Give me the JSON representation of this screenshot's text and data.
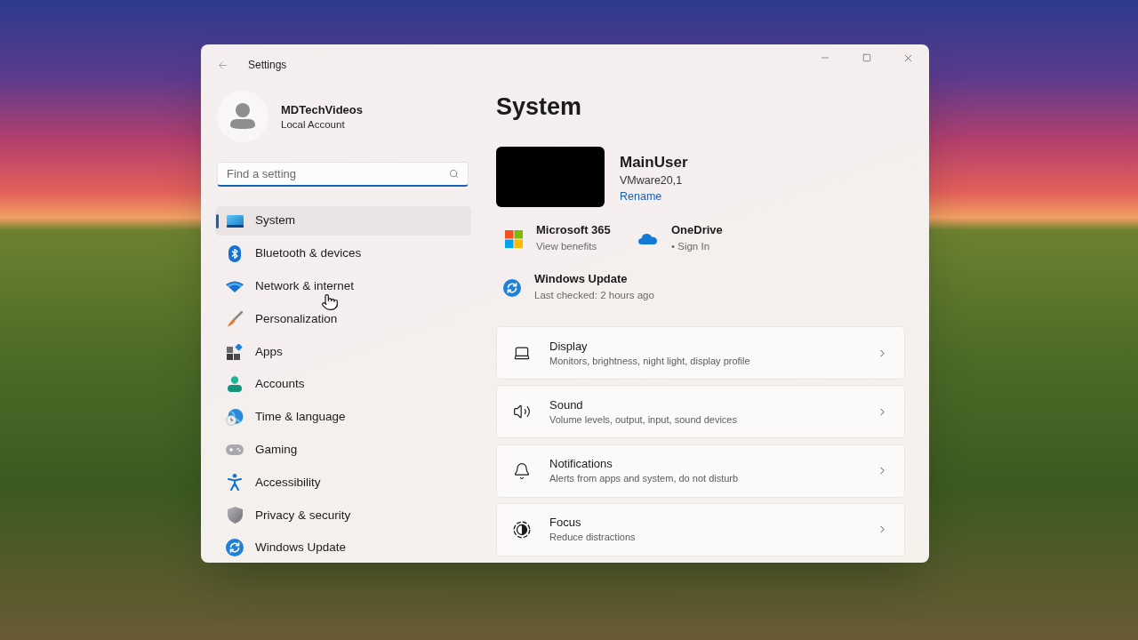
{
  "window": {
    "title": "Settings"
  },
  "profile": {
    "name": "MDTechVideos",
    "account_type": "Local Account"
  },
  "search": {
    "placeholder": "Find a setting"
  },
  "nav": [
    {
      "label": "System",
      "selected": true
    },
    {
      "label": "Bluetooth & devices",
      "selected": false
    },
    {
      "label": "Network & internet",
      "selected": false
    },
    {
      "label": "Personalization",
      "selected": false
    },
    {
      "label": "Apps",
      "selected": false
    },
    {
      "label": "Accounts",
      "selected": false
    },
    {
      "label": "Time & language",
      "selected": false
    },
    {
      "label": "Gaming",
      "selected": false
    },
    {
      "label": "Accessibility",
      "selected": false
    },
    {
      "label": "Privacy & security",
      "selected": false
    },
    {
      "label": "Windows Update",
      "selected": false
    }
  ],
  "page": {
    "title": "System"
  },
  "device": {
    "name": "MainUser",
    "model": "VMware20,1",
    "rename_link": "Rename"
  },
  "quick_links": [
    {
      "title": "Microsoft 365",
      "subtitle": "View benefits"
    },
    {
      "title": "OneDrive",
      "subtitle": "• Sign In"
    }
  ],
  "update": {
    "title": "Windows Update",
    "subtitle": "Last checked: 2 hours ago"
  },
  "cards": [
    {
      "title": "Display",
      "subtitle": "Monitors, brightness, night light, display profile"
    },
    {
      "title": "Sound",
      "subtitle": "Volume levels, output, input, sound devices"
    },
    {
      "title": "Notifications",
      "subtitle": "Alerts from apps and system, do not disturb"
    },
    {
      "title": "Focus",
      "subtitle": "Reduce distractions"
    }
  ]
}
